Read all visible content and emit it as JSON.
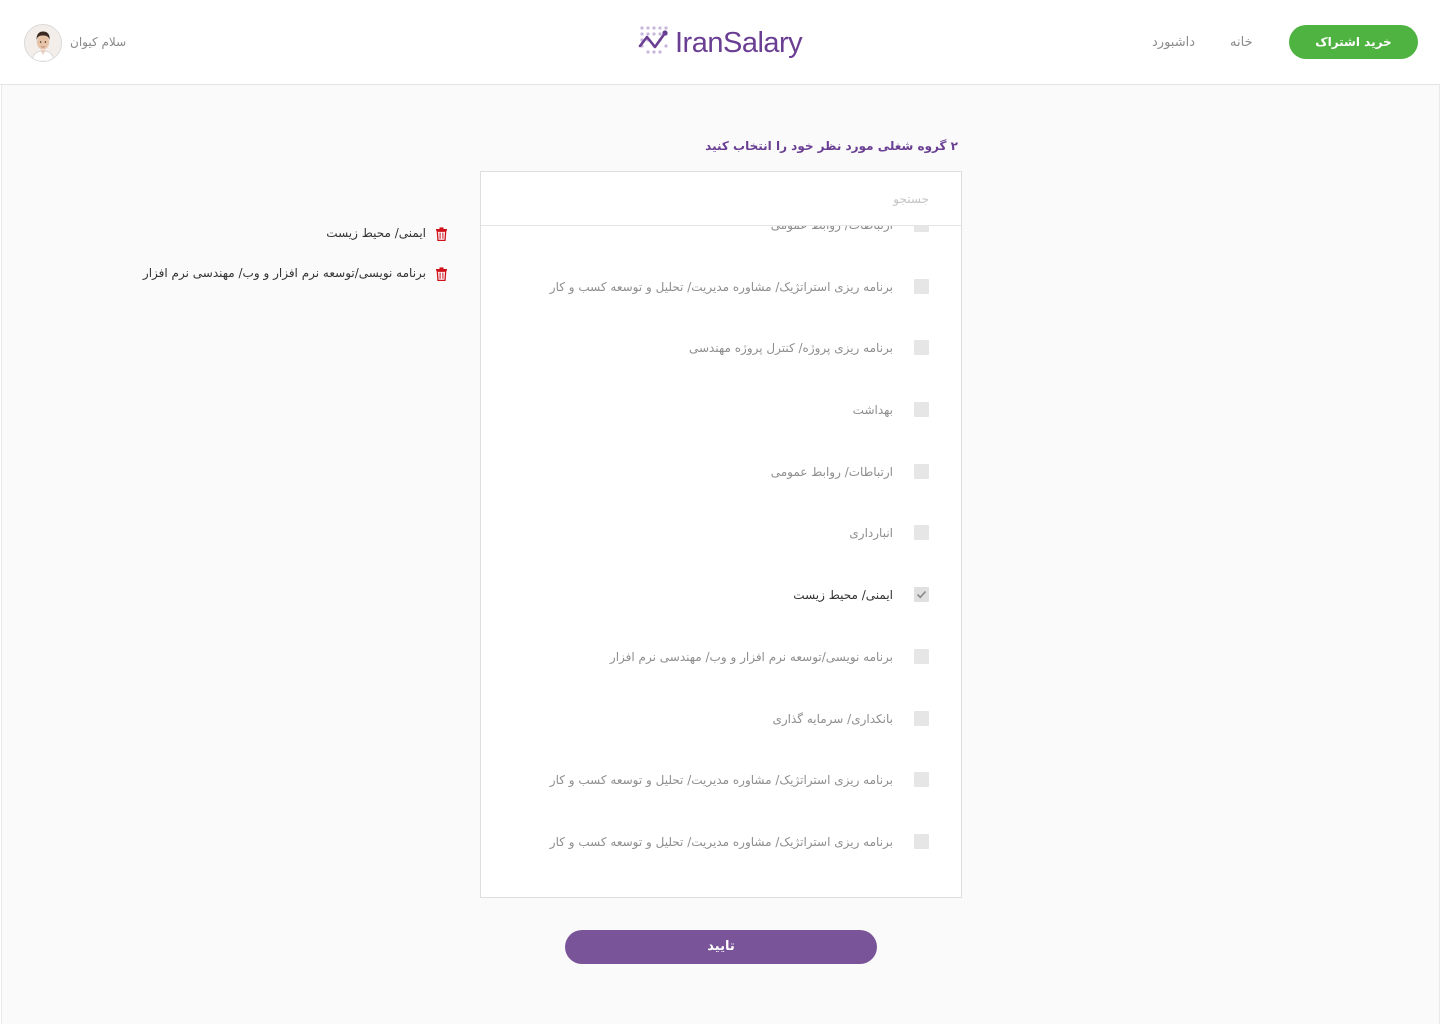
{
  "header": {
    "subscribe_label": "خرید اشتراک",
    "nav_home": "خانه",
    "nav_dashboard": "داشبورد",
    "logo_text": "IranSalary",
    "user_greeting": "سلام کیوان"
  },
  "main": {
    "instruction": "۲ گروه شغلی مورد نظر خود را انتخاب کنید",
    "search_placeholder": "جستجو",
    "items": [
      {
        "label": "ارتباطات/ روابط عمومی",
        "checked": false
      },
      {
        "label": "برنامه ریزی استراتژیک/ مشاوره مدیریت/ تحلیل و توسعه کسب و کار",
        "checked": false
      },
      {
        "label": "برنامه ریزی پروژه/ کنترل پروژه مهندسی",
        "checked": false
      },
      {
        "label": "بهداشت",
        "checked": false
      },
      {
        "label": "ارتباطات/ روابط عمومی",
        "checked": false
      },
      {
        "label": "انبارداری",
        "checked": false
      },
      {
        "label": "ایمنی/ محیط زیست",
        "checked": true
      },
      {
        "label": "برنامه نویسی/توسعه نرم افزار و وب/ مهندسی نرم افزار",
        "checked": false
      },
      {
        "label": "بانکداری/ سرمایه گذاری",
        "checked": false
      },
      {
        "label": "برنامه ریزی استراتژیک/ مشاوره مدیریت/ تحلیل و توسعه کسب و کار",
        "checked": false
      },
      {
        "label": "برنامه ریزی استراتژیک/ مشاوره مدیریت/ تحلیل و توسعه کسب و کار",
        "checked": false
      }
    ],
    "selected": [
      {
        "label": "ایمنی/ محیط زیست"
      },
      {
        "label": "برنامه نویسی/توسعه نرم افزار و وب/ مهندسی نرم افزار"
      }
    ],
    "confirm_label": "تایید"
  },
  "colors": {
    "brand_purple": "#6a3f93",
    "button_purple": "#7a5499",
    "subscribe_green": "#4fb341",
    "trash_red": "#d0121a"
  },
  "icons": [
    "logo-dots-icon",
    "avatar",
    "checkbox",
    "check-icon",
    "trash-icon"
  ]
}
